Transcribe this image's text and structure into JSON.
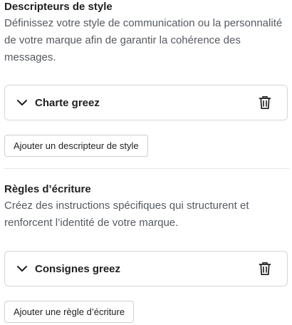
{
  "style_descriptors": {
    "title": "Descripteurs de style",
    "description": "Définissez votre style de communication ou la personnalité de votre marque afin de garantir la cohérence des messages.",
    "items": [
      {
        "label": "Charte greez"
      }
    ],
    "add_button_label": "Ajouter un descripteur de style"
  },
  "writing_rules": {
    "title": "Règles d’écriture",
    "description": "Créez des instructions spécifiques qui structurent et renforcent l’identité de votre marque.",
    "items": [
      {
        "label": "Consignes greez"
      }
    ],
    "add_button_label": "Ajouter une règle d’écriture"
  },
  "icons": {
    "expand": "chevron-down-icon",
    "delete": "trash-icon"
  }
}
